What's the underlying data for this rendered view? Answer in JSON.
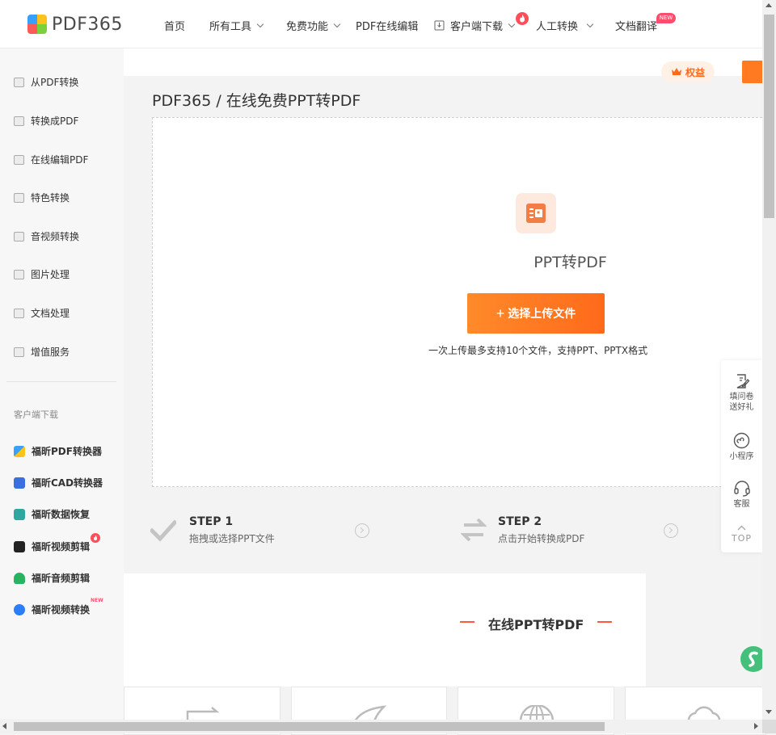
{
  "header": {
    "logo_text": "PDF365",
    "nav": [
      {
        "label": "首页",
        "has_dropdown": false
      },
      {
        "label": "所有工具",
        "has_dropdown": true
      },
      {
        "label": "免费功能",
        "has_dropdown": true
      },
      {
        "label": "PDF在线编辑",
        "has_dropdown": false
      },
      {
        "label": "客户端下载",
        "has_dropdown": true,
        "icon": "download-icon"
      },
      {
        "label": "人工转换",
        "has_dropdown": true,
        "badge_icon": "fire-icon"
      },
      {
        "label": "文档翻译",
        "has_dropdown": false,
        "badge": "NEW"
      }
    ]
  },
  "sidebar": {
    "items": [
      {
        "label": "从PDF转换",
        "icon": "from-pdf-icon"
      },
      {
        "label": "转换成PDF",
        "icon": "to-pdf-icon"
      },
      {
        "label": "在线编辑PDF",
        "icon": "edit-pdf-icon"
      },
      {
        "label": "特色转换",
        "icon": "special-convert-icon"
      },
      {
        "label": "音视频转换",
        "icon": "video-convert-icon"
      },
      {
        "label": "图片处理",
        "icon": "image-icon"
      },
      {
        "label": "文档处理",
        "icon": "document-icon"
      },
      {
        "label": "增值服务",
        "icon": "service-icon"
      }
    ],
    "download_title": "客户端下载",
    "downloads": [
      {
        "label": "福昕PDF转换器",
        "icon": "pdf-converter-app-icon",
        "color": "#4a7cf6"
      },
      {
        "label": "福昕CAD转换器",
        "icon": "cad-converter-app-icon",
        "color": "#3a6fe0"
      },
      {
        "label": "福昕数据恢复",
        "icon": "data-recovery-app-icon",
        "color": "#2fa7a0"
      },
      {
        "label": "福昕视频剪辑",
        "icon": "video-editor-app-icon",
        "color": "#222222",
        "badge": "fire"
      },
      {
        "label": "福昕音频剪辑",
        "icon": "audio-editor-app-icon",
        "color": "#27b35f"
      },
      {
        "label": "福昕视频转换",
        "icon": "video-converter-app-icon",
        "color": "#2b7ef5",
        "badge": "NEW"
      }
    ]
  },
  "main": {
    "quanyi_label": "权益",
    "breadcrumb": "PDF365 / 在线免费PPT转PDF",
    "upload": {
      "title": "PPT转PDF",
      "button_label": "选择上传文件",
      "hint": "一次上传最多支持10个文件，支持PPT、PPTX格式"
    },
    "steps": [
      {
        "title": "STEP 1",
        "desc": "拖拽或选择PPT文件"
      },
      {
        "title": "STEP 2",
        "desc": "点击开始转换成PDF"
      }
    ],
    "section_title": "在线PPT转PDF"
  },
  "float_panel": {
    "items": [
      {
        "label": "填问卷\n送好礼",
        "line1": "填问卷",
        "line2": "送好礼",
        "icon": "survey-icon"
      },
      {
        "label": "小程序",
        "icon": "mini-program-icon"
      },
      {
        "label": "客服",
        "icon": "headset-icon"
      }
    ],
    "top_label": "TOP"
  },
  "colors": {
    "accent": "#ff6a1a",
    "accent_light": "#fff1e6",
    "background": "#f3f3f3"
  }
}
